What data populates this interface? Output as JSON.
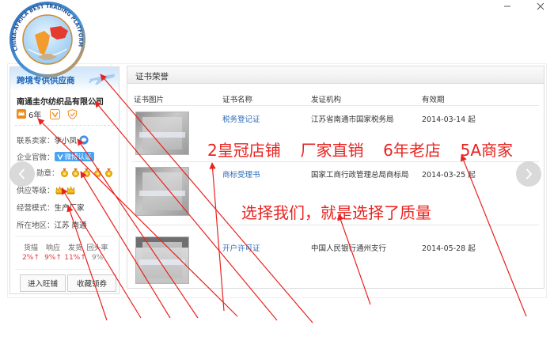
{
  "logo": {
    "text": "CHINA-AFRICA BEST TRADING PLATFORM"
  },
  "supplier": {
    "banner": "跨境专供供应商",
    "company": "南通圭尔纺织品有限公司",
    "years": "6年",
    "contact_label": "联系卖家：",
    "contact_name": "李小凤",
    "weibo_label": "企业官微：",
    "weibo_badge": "微博认证",
    "medal_label": "勋章：",
    "medal_count": 5,
    "level_label": "供应等级：",
    "crown_count": 2,
    "mode_label": "经营模式：",
    "mode_value": "生产厂家",
    "region_label": "所在地区：",
    "region_value": "江苏 南通",
    "stats": [
      {
        "label": "货描",
        "value": "2%↑"
      },
      {
        "label": "响应",
        "value": "9%↑"
      },
      {
        "label": "发货",
        "value": "11%↑"
      },
      {
        "label": "回头率",
        "value": "9%"
      }
    ],
    "enter_button": "进入旺铺",
    "favorite_button": "收藏领券"
  },
  "certificates": {
    "title": "证书荣誉",
    "columns": [
      "证书图片",
      "证书名称",
      "发证机构",
      "有效期"
    ],
    "rows": [
      {
        "name": "税务登记证",
        "issuer": "江苏省南通市国家税务局",
        "valid_from": "2014-03-14 起"
      },
      {
        "name": "商标受理书",
        "issuer": "国家工商行政管理总局商标局",
        "valid_from": "2014-03-25 起"
      },
      {
        "name": "开户许可证",
        "issuer": "中国人民银行通州支行",
        "valid_from": "2014-05-28 起"
      }
    ]
  },
  "annotations": {
    "headline": "2皇冠店铺  厂家直销  6年老店  5A商家",
    "slogan": "选择我们，就是选择了质量"
  },
  "icons": {
    "window": [
      "minimize-icon",
      "close-icon"
    ],
    "supplier": [
      "airplane-icon",
      "year-badge-icon",
      "trust-pass-icon",
      "guarantee-icon",
      "chat-icon",
      "weibo-v-icon",
      "medal-icon",
      "crown-icon"
    ],
    "nav": [
      "chevron-left-icon",
      "chevron-right-icon"
    ]
  },
  "colors": {
    "banner_blue": "#1b64b8",
    "link_blue": "#2c6bb8",
    "stat_red": "#e4393c",
    "annotation_red": "#e8231f",
    "badge_orange": "#f08a1c",
    "medal_gold": "#f5b400",
    "weibo_blue": "#4aa3f0"
  }
}
